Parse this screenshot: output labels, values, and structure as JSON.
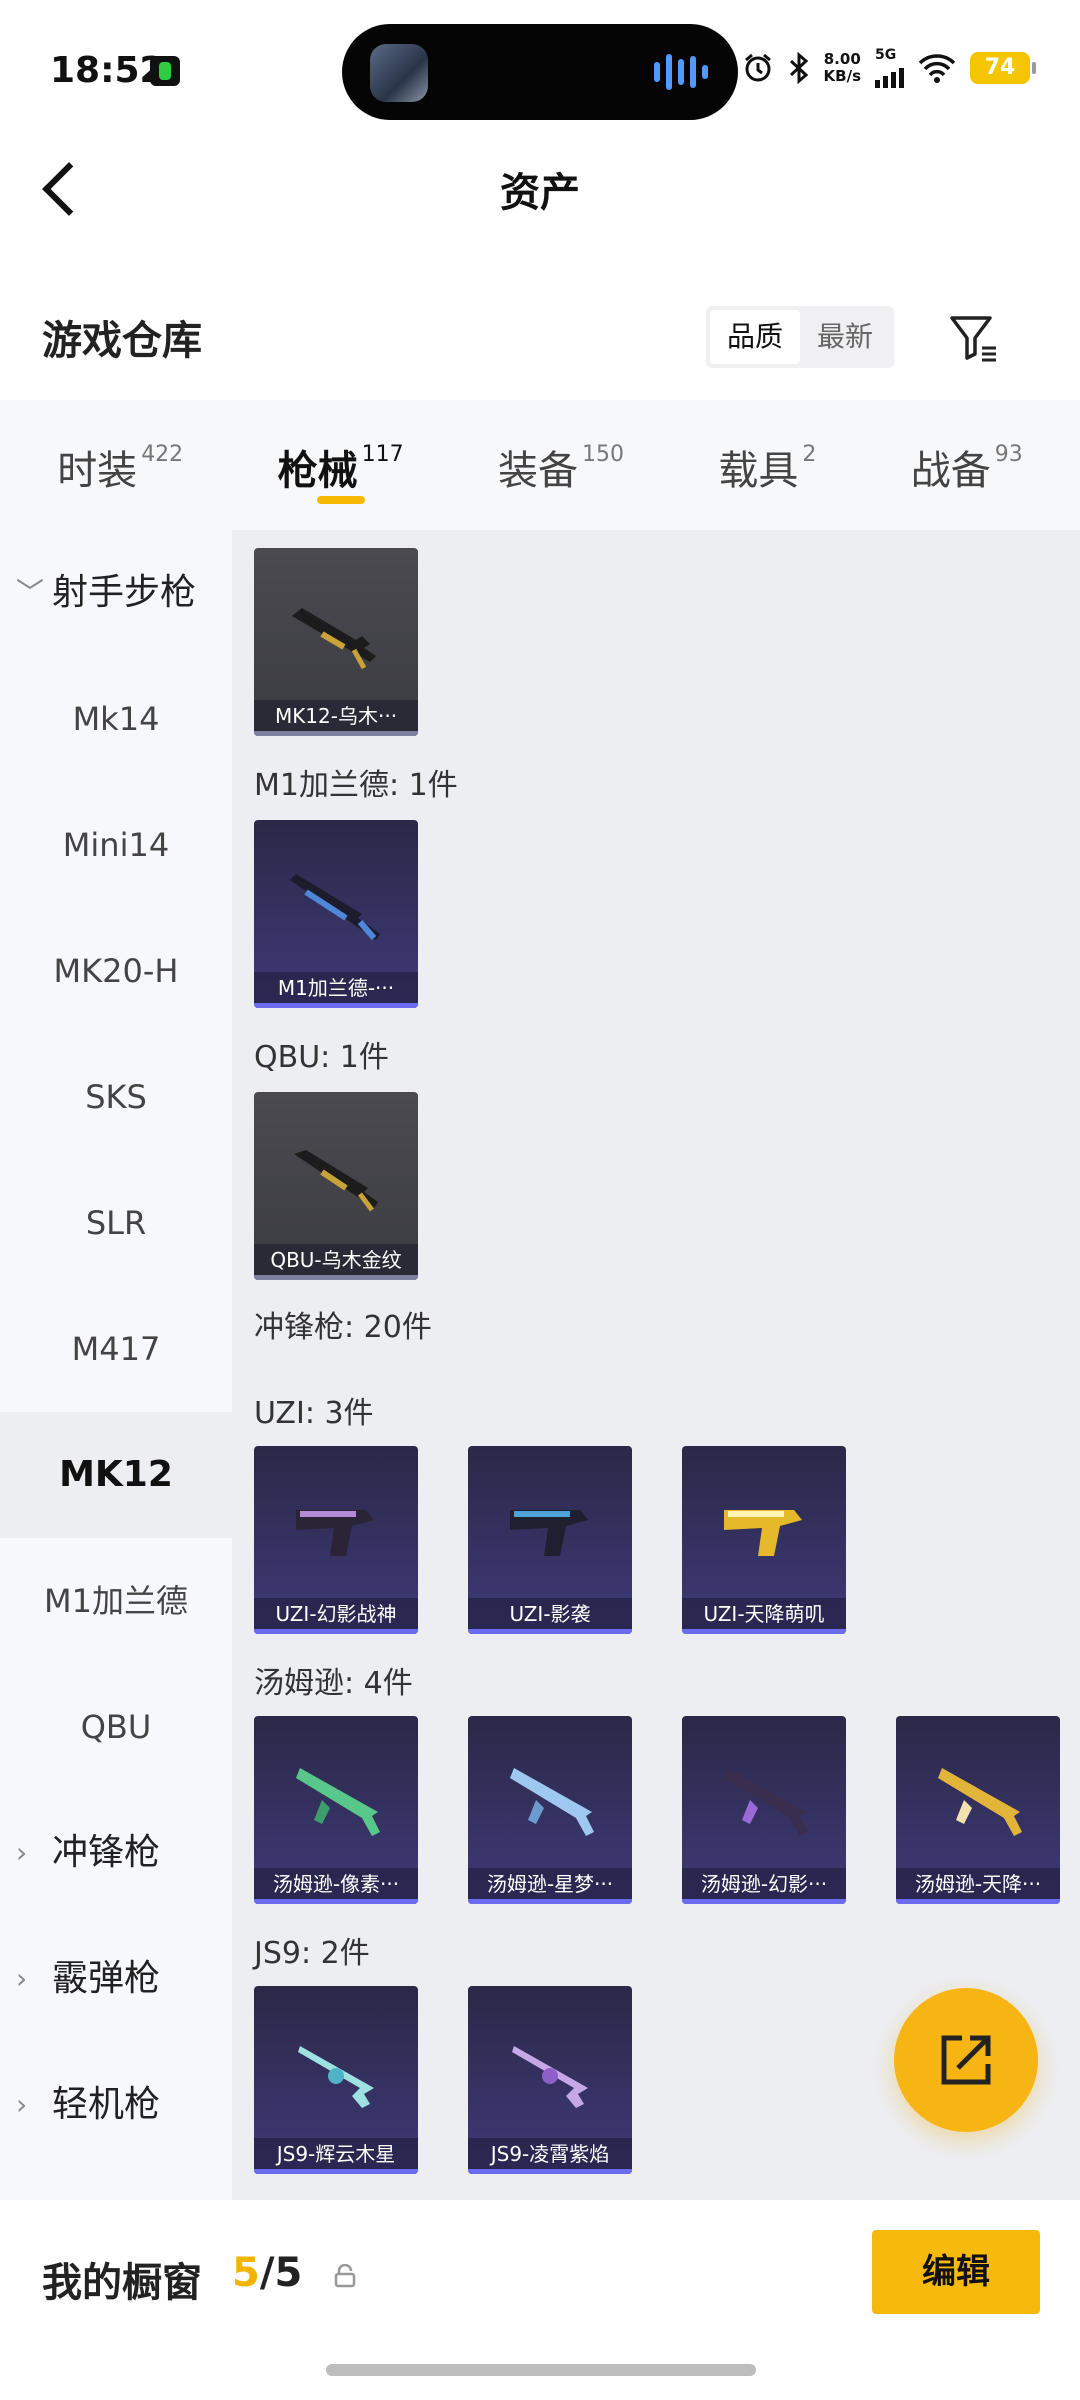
{
  "status": {
    "time": "18:52",
    "speed_value": "8.00",
    "speed_unit": "KB/s",
    "network": "5G",
    "battery": "74"
  },
  "header": {
    "title": "资产"
  },
  "warehouse": {
    "title": "游戏仓库",
    "sort_options": [
      "品质",
      "最新"
    ]
  },
  "tabs": [
    {
      "label": "时装",
      "count": "422"
    },
    {
      "label": "枪械",
      "count": "117"
    },
    {
      "label": "装备",
      "count": "150"
    },
    {
      "label": "载具",
      "count": "2"
    },
    {
      "label": "战备",
      "count": "93"
    }
  ],
  "sidebar": {
    "items": [
      {
        "label": "射手步枪"
      },
      {
        "label": "Mk14"
      },
      {
        "label": "Mini14"
      },
      {
        "label": "MK20-H"
      },
      {
        "label": "SKS"
      },
      {
        "label": "SLR"
      },
      {
        "label": "M417"
      },
      {
        "label": "MK12"
      },
      {
        "label": "M1加兰德"
      },
      {
        "label": "QBU"
      },
      {
        "label": "冲锋枪"
      },
      {
        "label": "霰弹枪"
      },
      {
        "label": "轻机枪"
      }
    ]
  },
  "content": {
    "card_mk12": "MK12-乌木···",
    "sec_m1": "M1加兰德: 1件",
    "card_m1": "M1加兰德-···",
    "sec_qbu": "QBU: 1件",
    "card_qbu": "QBU-乌木金纹",
    "sec_smg": "冲锋枪: 20件",
    "sec_uzi": "UZI: 3件",
    "uzi": [
      "UZI-幻影战神",
      "UZI-影袭",
      "UZI-天降萌叽"
    ],
    "sec_thompson": "汤姆逊: 4件",
    "thompson": [
      "汤姆逊-像素···",
      "汤姆逊-星梦···",
      "汤姆逊-幻影···",
      "汤姆逊-天降···"
    ],
    "sec_js9": "JS9: 2件",
    "js9": [
      "JS9-辉云木星",
      "JS9-凌霄紫焰"
    ]
  },
  "bottom": {
    "window_label": "我的橱窗",
    "window_used": "5",
    "window_total": "/5",
    "edit_label": "编辑"
  },
  "colors": {
    "accent": "#f7b90c",
    "purple_edge": "#6b6bf0"
  }
}
